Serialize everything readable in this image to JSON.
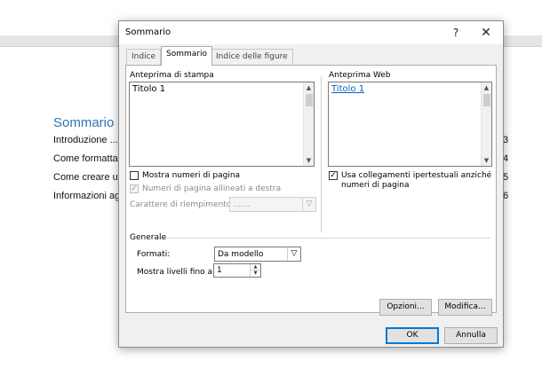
{
  "document": {
    "heading": "Sommario",
    "lines": [
      "Introduzione ...",
      "Come formatta",
      "Come creare ur",
      "Informazioni ag"
    ],
    "page_numbers": [
      "3",
      "4",
      "5",
      "6"
    ]
  },
  "dialog": {
    "title": "Sommario",
    "help": "?",
    "close": "✕",
    "tabs": [
      "Indice",
      "Sommario",
      "Indice delle figure"
    ],
    "print_preview": {
      "label": "Anteprima di stampa",
      "content": "Titolo 1",
      "show_page_numbers_label": "Mostra numeri di pagina",
      "show_page_numbers_checked": false,
      "right_align_label": "Numeri di pagina allineati a destra",
      "right_align_checked": true,
      "tab_leader_label": "Carattere di riempimento:",
      "tab_leader_value": "......."
    },
    "web_preview": {
      "label": "Anteprima Web",
      "content": "Titolo 1",
      "hyperlinks_label_line1": "Usa collegamenti ipertestuali anziché",
      "hyperlinks_label_line2": "numeri di pagina",
      "hyperlinks_checked": true
    },
    "general": {
      "section_label": "Generale",
      "formats_label": "Formati:",
      "formats_value": "Da modello",
      "levels_label": "Mostra livelli fino a:",
      "levels_value": "1"
    },
    "buttons": {
      "options": "Opzioni...",
      "modify": "Modifica...",
      "ok": "OK",
      "cancel": "Annulla"
    },
    "icons": {
      "dropdown": "▽",
      "scroll_up": "▲",
      "scroll_down": "▼",
      "check": "✓"
    }
  }
}
